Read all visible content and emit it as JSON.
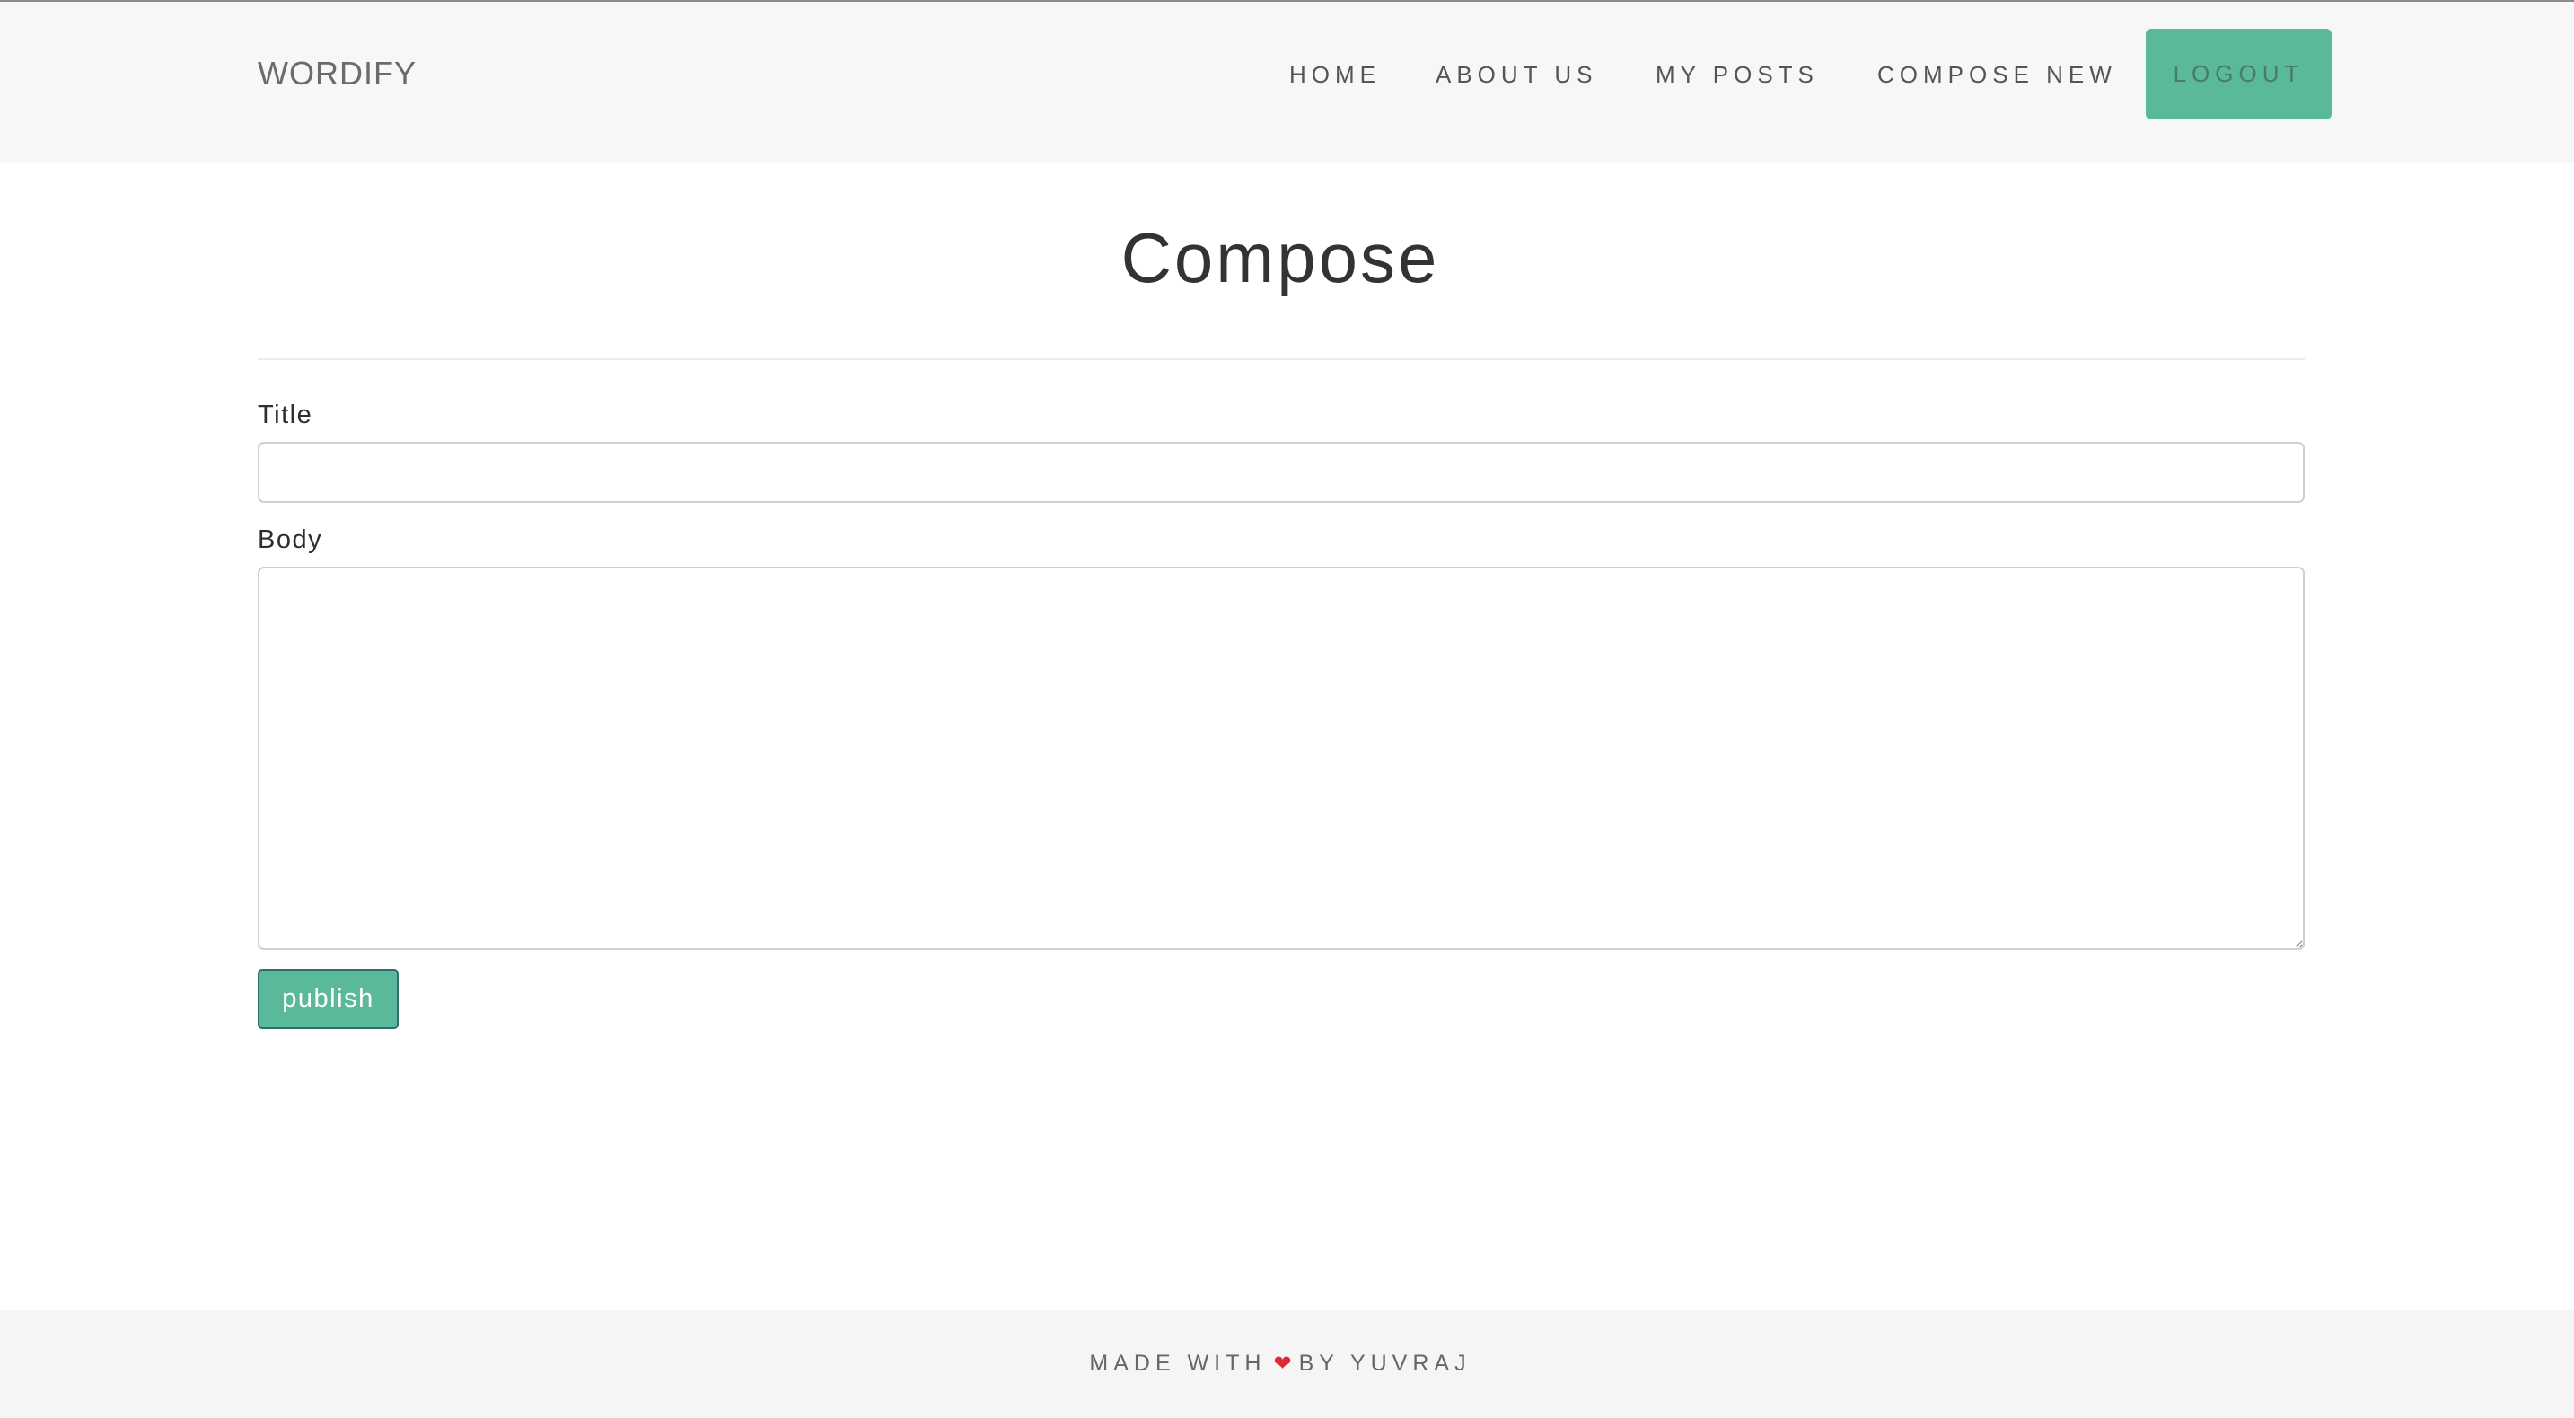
{
  "navbar": {
    "brand": "WORDIFY",
    "items": [
      {
        "label": "HOME"
      },
      {
        "label": "ABOUT US"
      },
      {
        "label": "MY POSTS"
      },
      {
        "label": "COMPOSE NEW"
      }
    ],
    "logout_label": "LOGOUT"
  },
  "main": {
    "title": "Compose",
    "form": {
      "title_label": "Title",
      "title_value": "",
      "body_label": "Body",
      "body_value": "",
      "submit_label": "publish"
    }
  },
  "footer": {
    "text_before": "MADE WITH",
    "heart_icon": "heart-icon",
    "text_after": "BY YUVRAJ"
  },
  "colors": {
    "accent": "#5bb99b",
    "navbar_bg": "#f7f7f7",
    "footer_bg": "#f5f5f5",
    "heart": "#e0273a"
  }
}
